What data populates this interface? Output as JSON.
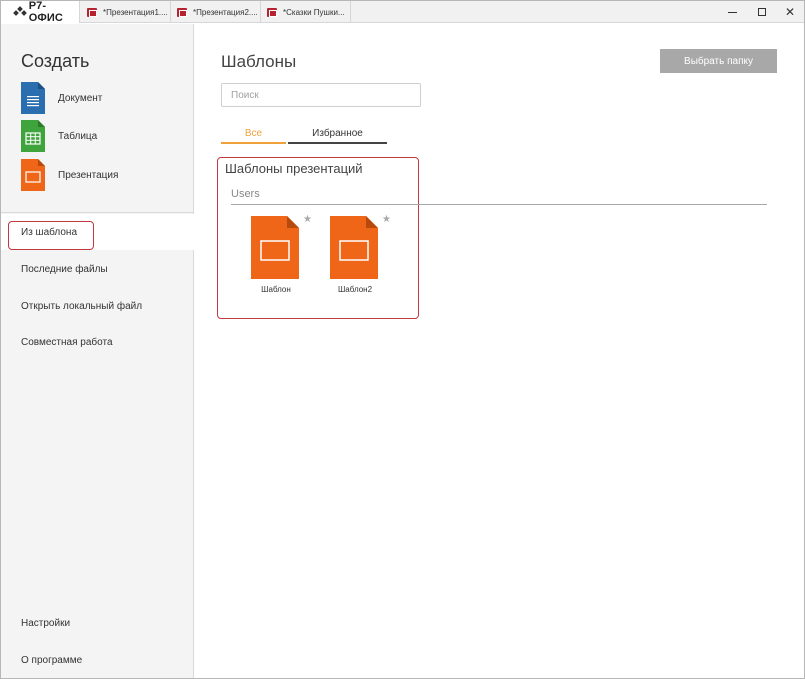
{
  "app": {
    "brand": "Р7-ОФИС",
    "tabs": [
      {
        "title": "*Презентация1...."
      },
      {
        "title": "*Презентация2...."
      },
      {
        "title": "*Сказки Пушки..."
      }
    ]
  },
  "sidebar": {
    "create_title": "Создать",
    "create_items": [
      {
        "label": "Документ",
        "icon": "document-icon",
        "color": "#2a6eb0"
      },
      {
        "label": "Таблица",
        "icon": "spreadsheet-icon",
        "color": "#40a43d"
      },
      {
        "label": "Презентация",
        "icon": "presentation-icon",
        "color": "#f06618"
      }
    ],
    "items": [
      {
        "label": "Из шаблона",
        "active": true
      },
      {
        "label": "Последние файлы"
      },
      {
        "label": "Открыть локальный файл"
      },
      {
        "label": "Совместная работа"
      }
    ],
    "bottom_items": [
      {
        "label": "Настройки"
      },
      {
        "label": "О программе"
      }
    ]
  },
  "main": {
    "title": "Шаблоны",
    "choose_folder_label": "Выбрать папку",
    "search": {
      "placeholder": "Поиск",
      "value": ""
    },
    "tabs": [
      {
        "label": "Все",
        "active": true
      },
      {
        "label": "Избранное",
        "active": false
      }
    ],
    "section_title": "Шаблоны презентаций",
    "group_label": "Users",
    "templates": [
      {
        "name": "Шаблон",
        "starred": false
      },
      {
        "name": "Шаблон2",
        "starred": false
      }
    ]
  },
  "colors": {
    "accent": "#f0a23a",
    "presentation": "#f06618",
    "highlight": "#c0393f"
  }
}
